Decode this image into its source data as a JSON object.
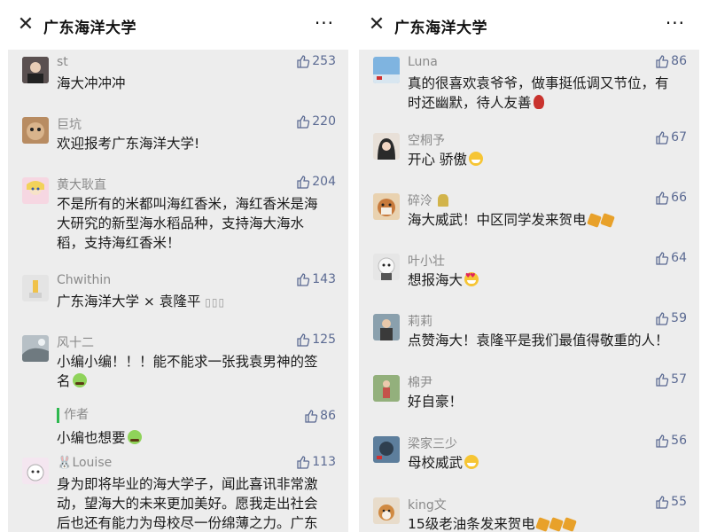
{
  "left": {
    "header": {
      "title": "广东海洋大学",
      "close_icon": "close-icon",
      "more_label": "···"
    },
    "comments": [
      {
        "name": "st",
        "likes": "253",
        "text": "海大冲冲冲",
        "avatar_color": "#3a3a3a"
      },
      {
        "name": "巨坑",
        "likes": "220",
        "text": "欢迎报考广东海洋大学!",
        "avatar_color": "#c9a27a"
      },
      {
        "name": "黄大耿直",
        "likes": "204",
        "text": "不是所有的米都叫海红香米，海红香米是海大研究的新型海水稻品种，支持海大海水稻，支持海红香米！",
        "avatar_color": "#f2b6c8"
      },
      {
        "name": "Chwithin",
        "likes": "143",
        "text": "广东海洋大学 × 袁隆平",
        "badge": "▯▯▯",
        "avatar_color": "#d9d9d9"
      },
      {
        "name": "风十二",
        "likes": "125",
        "text": "小编小编！！！能不能求一张我袁男神的签名",
        "avatar_color": "#9aa3a8",
        "reply": {
          "author": "作者",
          "likes": "86",
          "text": "小编也想要"
        }
      },
      {
        "name": "Louise",
        "name_prefix_icon": "bunny-icon",
        "likes": "113",
        "text": "身为即将毕业的海大学子，闻此喜讯非常激动，望海大的未来更加美好。愿我走出社会后也还有能力为母校尽一份绵薄之力。广东",
        "avatar_color": "#e7d6e7"
      }
    ]
  },
  "right": {
    "header": {
      "title": "广东海洋大学",
      "close_icon": "close-icon",
      "more_label": "···"
    },
    "comments": [
      {
        "name": "Luna",
        "likes": "86",
        "text": "真的很喜欢袁爷爷，做事挺低调又节位，有时还幽默，待人友善",
        "avatar_color": "#6fa8d6"
      },
      {
        "name": "空桐予",
        "likes": "67",
        "text": "开心 骄傲",
        "avatar_color": "#3c3c3c"
      },
      {
        "name": "碎泠",
        "likes": "66",
        "text": "海大威武！中区同学发来贺电",
        "avatar_color": "#c07a3a"
      },
      {
        "name": "叶小壮",
        "likes": "64",
        "text": "想报海大",
        "avatar_color": "#dcdcdc"
      },
      {
        "name": "莉莉",
        "likes": "59",
        "text": "点赞海大！袁隆平是我们最值得敬重的人！",
        "avatar_color": "#7a8f9c"
      },
      {
        "name": "棉尹",
        "likes": "57",
        "text": "好自豪！",
        "avatar_color": "#5f7b4e"
      },
      {
        "name": "梁家三少",
        "likes": "56",
        "text": "母校威武",
        "avatar_color": "#4a6a8a"
      },
      {
        "name": "king文",
        "likes": "55",
        "text": "15级老油条发来贺电",
        "avatar_color": "#c98b4a"
      }
    ]
  },
  "colors": {
    "like": "#5b6a92",
    "panel_bg": "#ededed",
    "header_bg": "#ffffff",
    "reply_bar": "#2eb84f"
  }
}
